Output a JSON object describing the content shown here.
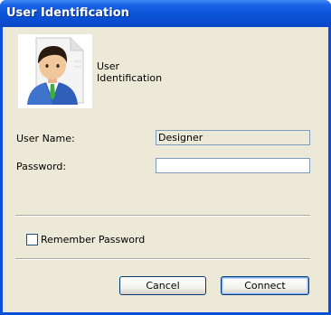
{
  "window": {
    "title": "User Identification"
  },
  "header": {
    "icon": "user-avatar-icon",
    "caption_line1": "User",
    "caption_line2": "Identification"
  },
  "form": {
    "username_label": "User Name:",
    "username_value": "Designer",
    "password_label": "Password:",
    "password_value": "",
    "remember_label": "Remember Password",
    "remember_checked": false
  },
  "buttons": {
    "cancel_label": "Cancel",
    "connect_label": "Connect"
  },
  "colors": {
    "titlebar": "#0b54d8",
    "dialog_bg": "#ece9d8",
    "field_border": "#7f9db9"
  }
}
